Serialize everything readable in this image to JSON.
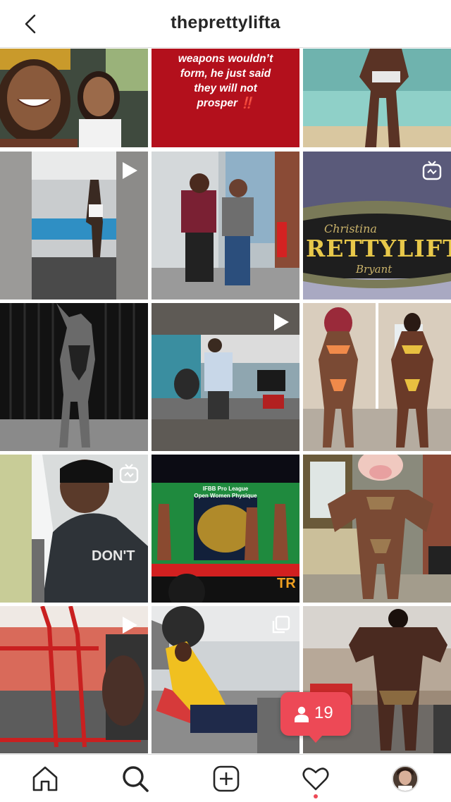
{
  "header": {
    "title": "theprettylifta",
    "back_icon": "chevron-left-icon"
  },
  "grid": {
    "tiles": [
      {
        "desc": "selfie-car",
        "badge": null
      },
      {
        "desc": "story-text",
        "badge": null,
        "text_lines": [
          "weapons wouldn’t",
          "form, he just said",
          "they will not",
          "prosper"
        ],
        "text_emphasis": "‼️"
      },
      {
        "desc": "beach",
        "badge": null
      },
      {
        "desc": "gym-stretch",
        "badge": "play-icon"
      },
      {
        "desc": "two-friends",
        "badge": null
      },
      {
        "desc": "belt",
        "badge": "igtv-icon",
        "belt_name_top": "Christina",
        "belt_name_main": "RETTYLIFTA",
        "belt_name_bottom": "Bryant"
      },
      {
        "desc": "bw-pose",
        "badge": null
      },
      {
        "desc": "gym-coach",
        "badge": "play-icon"
      },
      {
        "desc": "two-bikini",
        "badge": null
      },
      {
        "desc": "car-selfie",
        "badge": "igtv-icon"
      },
      {
        "desc": "stage",
        "badge": null,
        "stage_line1": "IFBB Pro League",
        "stage_line2": "Open Women Physique",
        "sponsor_text": "TR"
      },
      {
        "desc": "cow-mask",
        "badge": null
      },
      {
        "desc": "gym-machine",
        "badge": "play-icon"
      },
      {
        "desc": "bench-press",
        "badge": "carousel-icon"
      },
      {
        "desc": "back-pose",
        "badge": null
      }
    ]
  },
  "notification": {
    "icon": "person-icon",
    "count": "19",
    "color": "#ed4956"
  },
  "tabbar": {
    "items": [
      "home-icon",
      "search-icon",
      "add-icon",
      "heart-icon",
      "profile-avatar"
    ],
    "active_dot_color": "#ed4956"
  }
}
